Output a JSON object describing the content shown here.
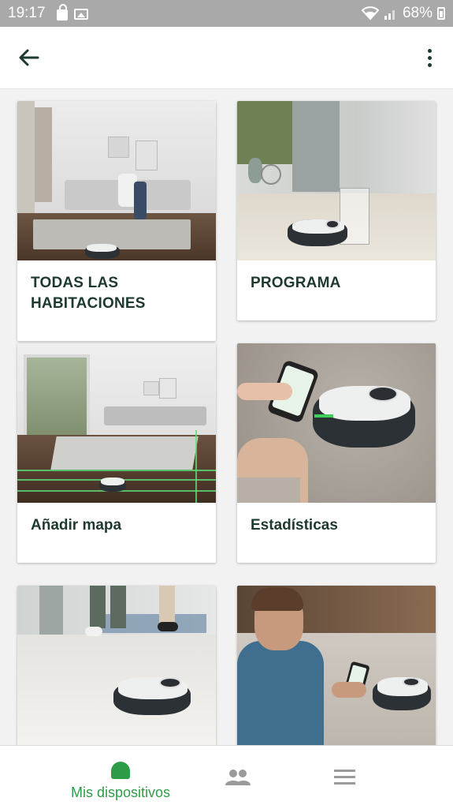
{
  "status_bar": {
    "time": "19:17",
    "battery": "68%",
    "icons": [
      "lock-icon",
      "image-icon",
      "wifi-icon",
      "signal-icon",
      "battery-icon"
    ]
  },
  "app_bar": {
    "back_icon": "arrow-back-icon",
    "more_icon": "more-vert-icon"
  },
  "cards": [
    {
      "label": "TODAS LAS HABITACIONES",
      "image": "living-room-robot-photo"
    },
    {
      "label": "PROGRAMA",
      "image": "robot-docking-photo"
    },
    {
      "label": "Añadir mapa",
      "image": "living-room-map-lines-photo"
    },
    {
      "label": "Estadísticas",
      "image": "phone-app-robot-photo"
    },
    {
      "label": "",
      "image": "robot-cleaning-floor-photo"
    },
    {
      "label": "",
      "image": "man-with-phone-robot-photo"
    }
  ],
  "bottom_nav": {
    "items": [
      {
        "label": "Mis dispositivos",
        "icon": "robot-device-icon",
        "active": true
      },
      {
        "label": "",
        "icon": "people-icon",
        "active": false
      },
      {
        "label": "",
        "icon": "menu-icon",
        "active": false
      }
    ]
  },
  "colors": {
    "accent": "#2e9c47",
    "text": "#1e3a2e",
    "status_bar": "#a9a9a9"
  }
}
